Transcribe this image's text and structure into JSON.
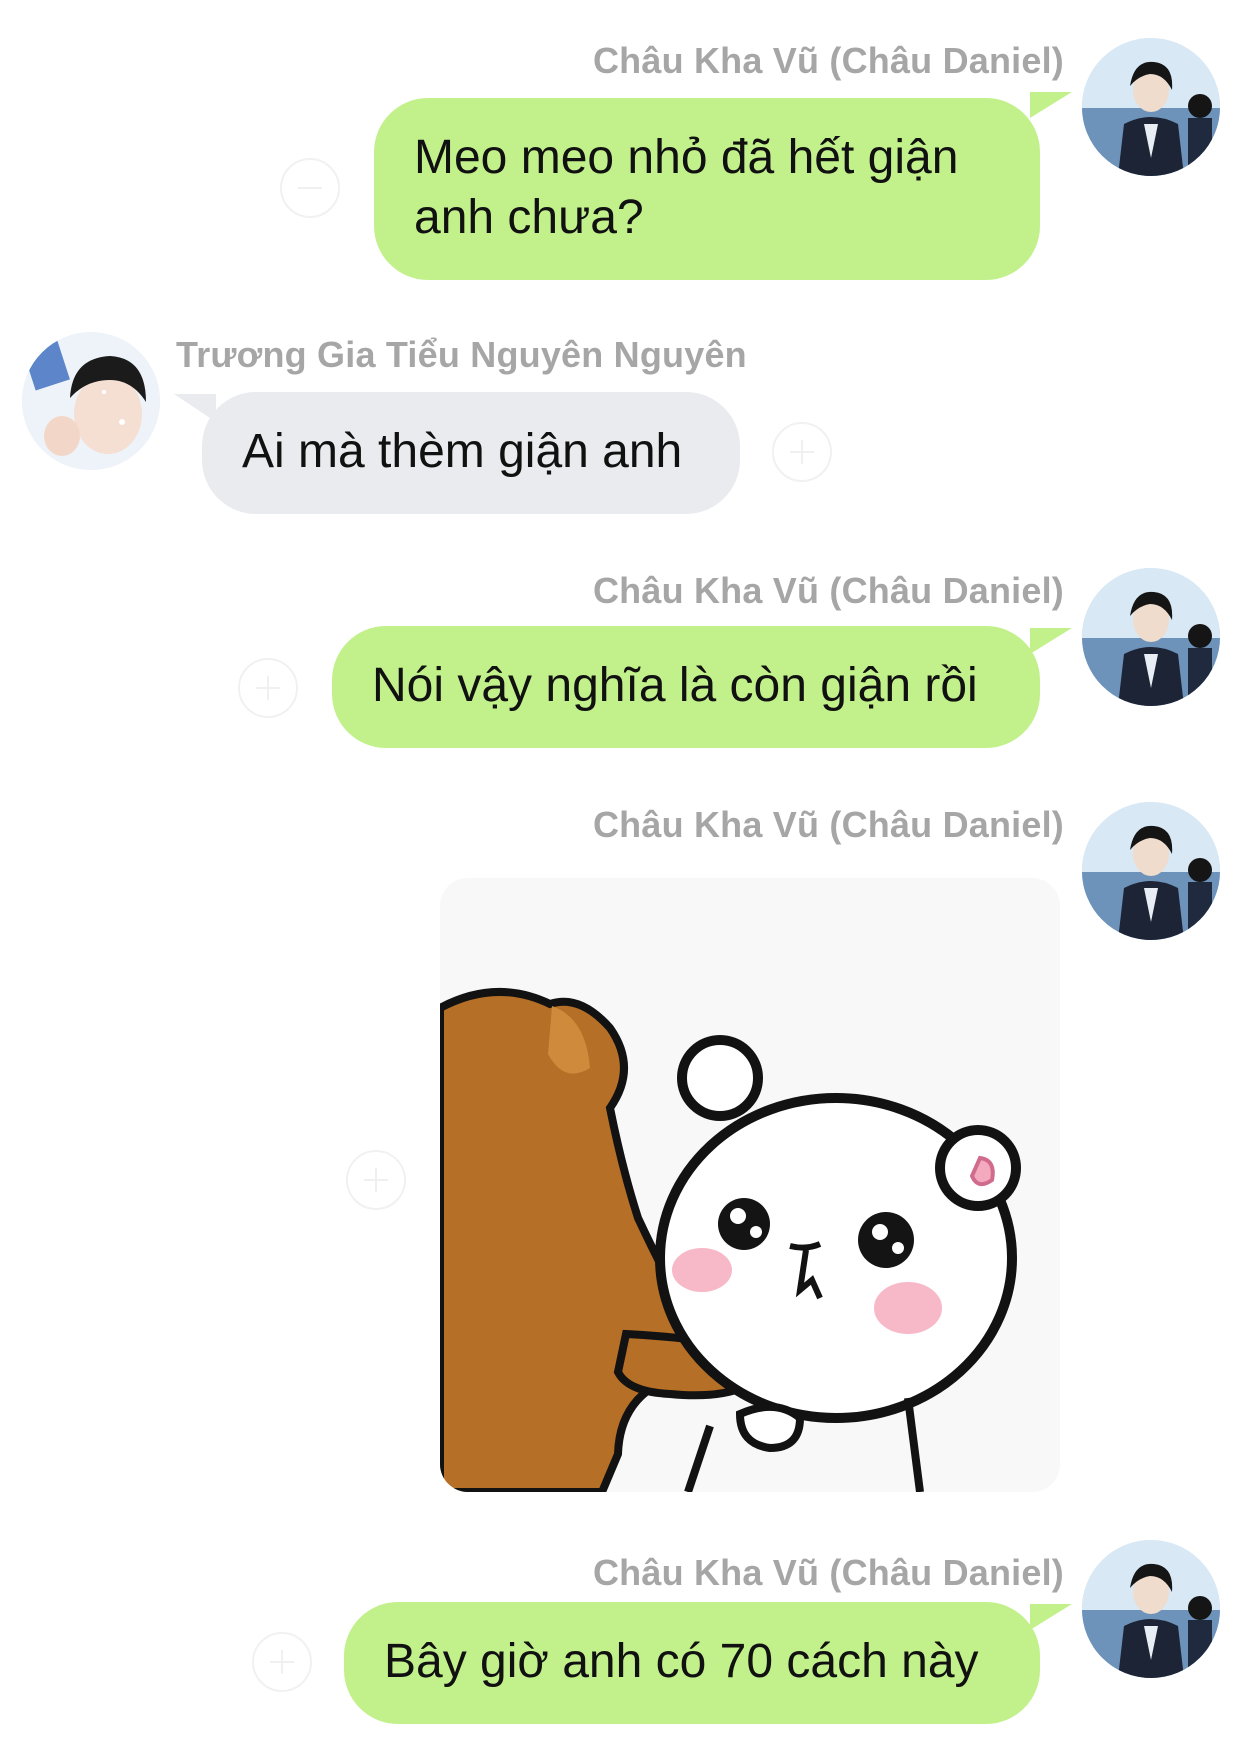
{
  "messages": [
    {
      "sender": "Châu Kha Vũ (Châu Daniel)",
      "text_lines": [
        "Meo meo nhỏ đã hết giận",
        "anh chưa?"
      ]
    },
    {
      "sender": "Trương Gia Tiểu Nguyên Nguyên",
      "text": "Ai mà thèm giận anh"
    },
    {
      "sender": "Châu Kha Vũ (Châu Daniel)",
      "text": "Nói vậy nghĩa là còn giận rồi"
    },
    {
      "sender": "Châu Kha Vũ (Châu Daniel)",
      "sticker": "crying-bear-sticker"
    },
    {
      "sender": "Châu Kha Vũ (Châu Daniel)",
      "text": "Bây giờ anh có 70 cách này"
    }
  ],
  "colors": {
    "self_bubble": "#c2f18c",
    "other_bubble": "#e9ebee",
    "sender_name": "#a6a6a6"
  },
  "icons": [
    "avatar-self",
    "avatar-other",
    "add-reaction-icon",
    "sticker-image"
  ]
}
